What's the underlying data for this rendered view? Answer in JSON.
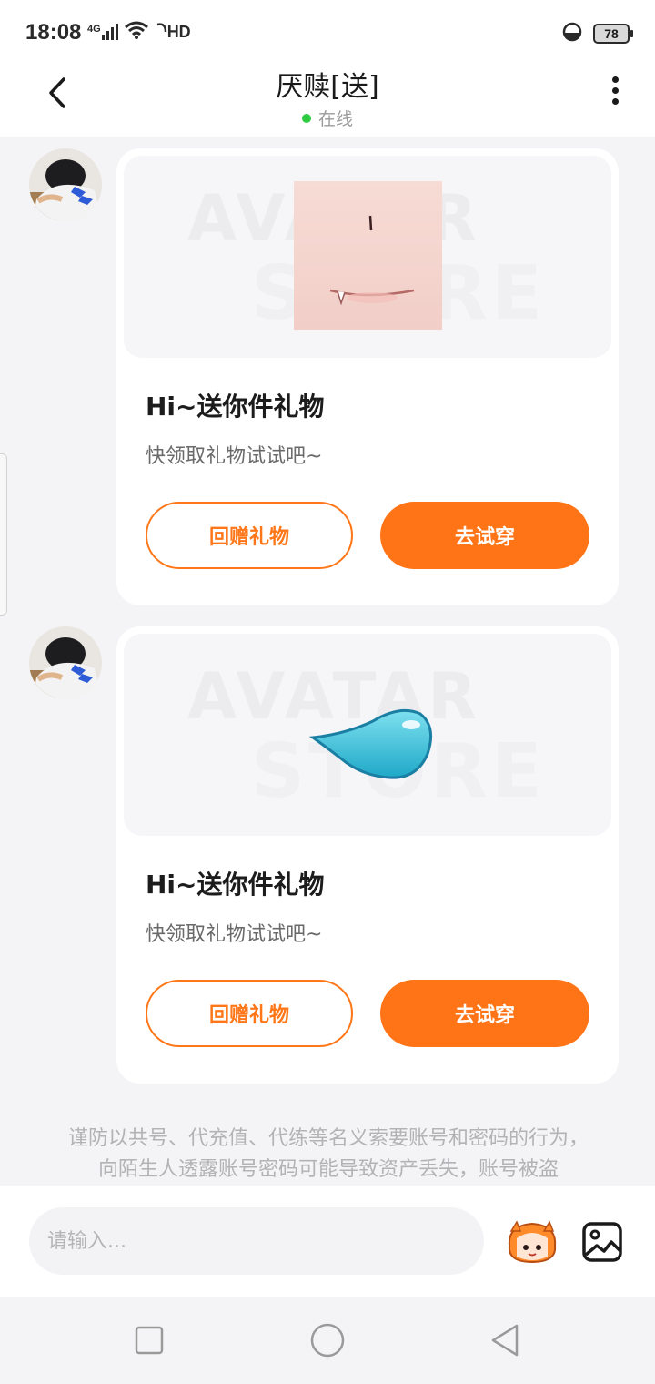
{
  "status_bar": {
    "time": "18:08",
    "network": "4G",
    "hd": "HD",
    "battery": "78"
  },
  "header": {
    "title": "厌赎[送]",
    "presence": "在线"
  },
  "messages": [
    {
      "watermark_line1": "AVATAR",
      "watermark_line2": "STORE",
      "title": "Hi~送你件礼物",
      "subtitle": "快领取礼物试试吧~",
      "return_gift_label": "回赠礼物",
      "try_on_label": "去试穿"
    },
    {
      "watermark_line1": "AVATAR",
      "watermark_line2": "STORE",
      "title": "Hi~送你件礼物",
      "subtitle": "快领取礼物试试吧~",
      "return_gift_label": "回赠礼物",
      "try_on_label": "去试穿"
    }
  ],
  "notice": "谨防以共号、代充值、代练等名义索要账号和密码的行为，向陌生人透露账号密码可能导致资产丢失，账号被盗",
  "input": {
    "placeholder": "请输入..."
  },
  "colors": {
    "accent": "#ff7416",
    "online": "#2ecc40"
  }
}
